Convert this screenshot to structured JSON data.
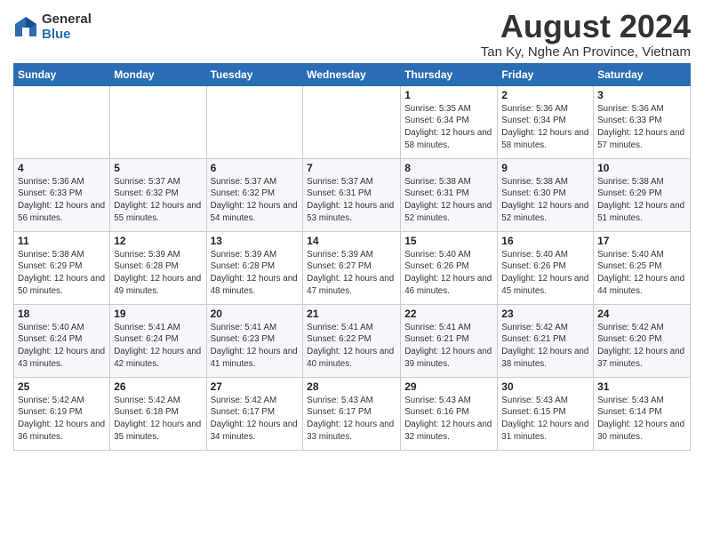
{
  "logo": {
    "general": "General",
    "blue": "Blue"
  },
  "title": "August 2024",
  "location": "Tan Ky, Nghe An Province, Vietnam",
  "days_of_week": [
    "Sunday",
    "Monday",
    "Tuesday",
    "Wednesday",
    "Thursday",
    "Friday",
    "Saturday"
  ],
  "weeks": [
    [
      {
        "day": "",
        "info": ""
      },
      {
        "day": "",
        "info": ""
      },
      {
        "day": "",
        "info": ""
      },
      {
        "day": "",
        "info": ""
      },
      {
        "day": "1",
        "info": "Sunrise: 5:35 AM\nSunset: 6:34 PM\nDaylight: 12 hours\nand 58 minutes."
      },
      {
        "day": "2",
        "info": "Sunrise: 5:36 AM\nSunset: 6:34 PM\nDaylight: 12 hours\nand 58 minutes."
      },
      {
        "day": "3",
        "info": "Sunrise: 5:36 AM\nSunset: 6:33 PM\nDaylight: 12 hours\nand 57 minutes."
      }
    ],
    [
      {
        "day": "4",
        "info": "Sunrise: 5:36 AM\nSunset: 6:33 PM\nDaylight: 12 hours\nand 56 minutes."
      },
      {
        "day": "5",
        "info": "Sunrise: 5:37 AM\nSunset: 6:32 PM\nDaylight: 12 hours\nand 55 minutes."
      },
      {
        "day": "6",
        "info": "Sunrise: 5:37 AM\nSunset: 6:32 PM\nDaylight: 12 hours\nand 54 minutes."
      },
      {
        "day": "7",
        "info": "Sunrise: 5:37 AM\nSunset: 6:31 PM\nDaylight: 12 hours\nand 53 minutes."
      },
      {
        "day": "8",
        "info": "Sunrise: 5:38 AM\nSunset: 6:31 PM\nDaylight: 12 hours\nand 52 minutes."
      },
      {
        "day": "9",
        "info": "Sunrise: 5:38 AM\nSunset: 6:30 PM\nDaylight: 12 hours\nand 52 minutes."
      },
      {
        "day": "10",
        "info": "Sunrise: 5:38 AM\nSunset: 6:29 PM\nDaylight: 12 hours\nand 51 minutes."
      }
    ],
    [
      {
        "day": "11",
        "info": "Sunrise: 5:38 AM\nSunset: 6:29 PM\nDaylight: 12 hours\nand 50 minutes."
      },
      {
        "day": "12",
        "info": "Sunrise: 5:39 AM\nSunset: 6:28 PM\nDaylight: 12 hours\nand 49 minutes."
      },
      {
        "day": "13",
        "info": "Sunrise: 5:39 AM\nSunset: 6:28 PM\nDaylight: 12 hours\nand 48 minutes."
      },
      {
        "day": "14",
        "info": "Sunrise: 5:39 AM\nSunset: 6:27 PM\nDaylight: 12 hours\nand 47 minutes."
      },
      {
        "day": "15",
        "info": "Sunrise: 5:40 AM\nSunset: 6:26 PM\nDaylight: 12 hours\nand 46 minutes."
      },
      {
        "day": "16",
        "info": "Sunrise: 5:40 AM\nSunset: 6:26 PM\nDaylight: 12 hours\nand 45 minutes."
      },
      {
        "day": "17",
        "info": "Sunrise: 5:40 AM\nSunset: 6:25 PM\nDaylight: 12 hours\nand 44 minutes."
      }
    ],
    [
      {
        "day": "18",
        "info": "Sunrise: 5:40 AM\nSunset: 6:24 PM\nDaylight: 12 hours\nand 43 minutes."
      },
      {
        "day": "19",
        "info": "Sunrise: 5:41 AM\nSunset: 6:24 PM\nDaylight: 12 hours\nand 42 minutes."
      },
      {
        "day": "20",
        "info": "Sunrise: 5:41 AM\nSunset: 6:23 PM\nDaylight: 12 hours\nand 41 minutes."
      },
      {
        "day": "21",
        "info": "Sunrise: 5:41 AM\nSunset: 6:22 PM\nDaylight: 12 hours\nand 40 minutes."
      },
      {
        "day": "22",
        "info": "Sunrise: 5:41 AM\nSunset: 6:21 PM\nDaylight: 12 hours\nand 39 minutes."
      },
      {
        "day": "23",
        "info": "Sunrise: 5:42 AM\nSunset: 6:21 PM\nDaylight: 12 hours\nand 38 minutes."
      },
      {
        "day": "24",
        "info": "Sunrise: 5:42 AM\nSunset: 6:20 PM\nDaylight: 12 hours\nand 37 minutes."
      }
    ],
    [
      {
        "day": "25",
        "info": "Sunrise: 5:42 AM\nSunset: 6:19 PM\nDaylight: 12 hours\nand 36 minutes."
      },
      {
        "day": "26",
        "info": "Sunrise: 5:42 AM\nSunset: 6:18 PM\nDaylight: 12 hours\nand 35 minutes."
      },
      {
        "day": "27",
        "info": "Sunrise: 5:42 AM\nSunset: 6:17 PM\nDaylight: 12 hours\nand 34 minutes."
      },
      {
        "day": "28",
        "info": "Sunrise: 5:43 AM\nSunset: 6:17 PM\nDaylight: 12 hours\nand 33 minutes."
      },
      {
        "day": "29",
        "info": "Sunrise: 5:43 AM\nSunset: 6:16 PM\nDaylight: 12 hours\nand 32 minutes."
      },
      {
        "day": "30",
        "info": "Sunrise: 5:43 AM\nSunset: 6:15 PM\nDaylight: 12 hours\nand 31 minutes."
      },
      {
        "day": "31",
        "info": "Sunrise: 5:43 AM\nSunset: 6:14 PM\nDaylight: 12 hours\nand 30 minutes."
      }
    ]
  ]
}
